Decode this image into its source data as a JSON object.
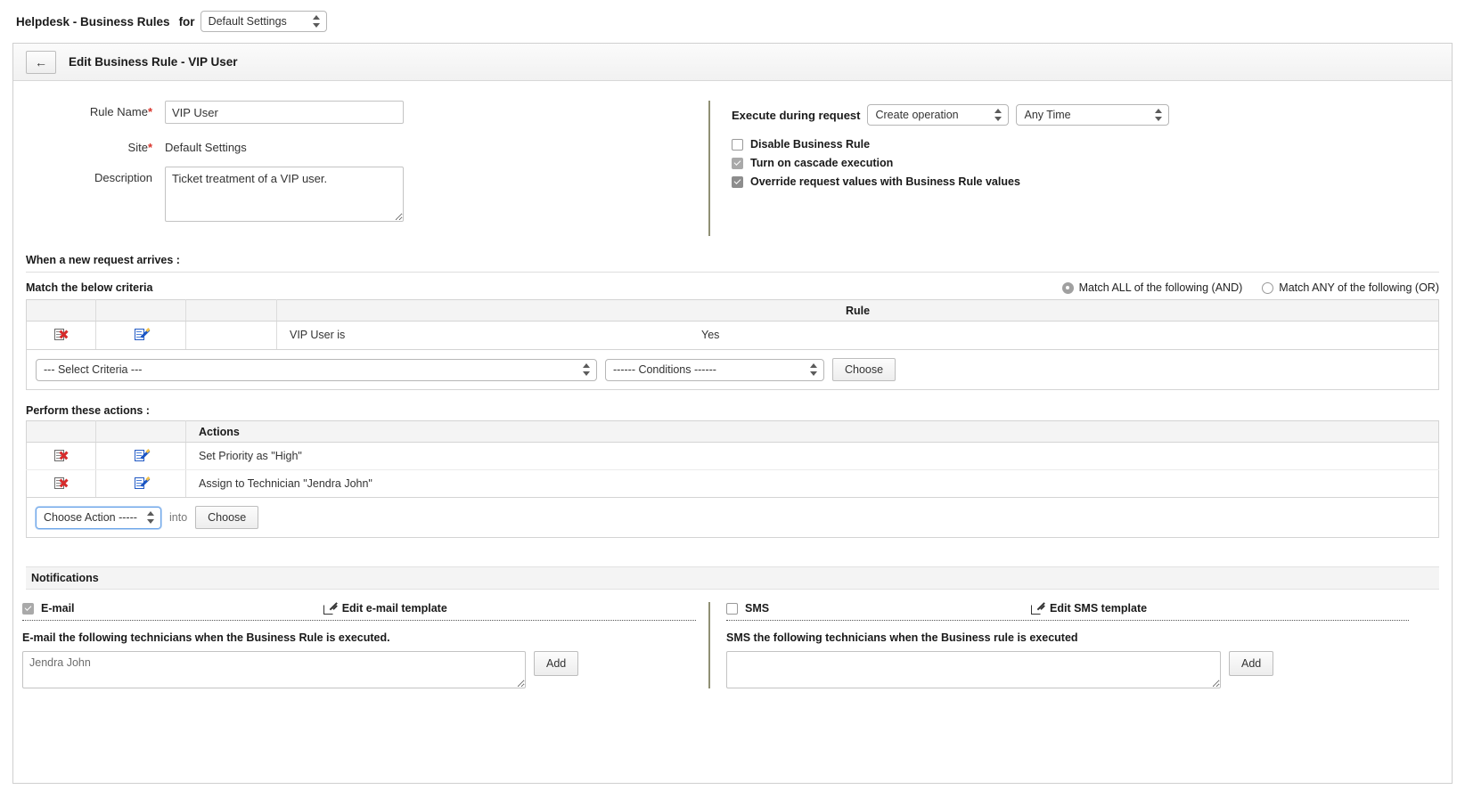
{
  "topbar": {
    "title_strong": "Helpdesk - Business Rules",
    "for_label": "for",
    "site_select_value": "Default Settings",
    "site_select_name": "site-scope-select"
  },
  "panel": {
    "back_icon": "arrow-left-icon",
    "heading": "Edit Business Rule - VIP User"
  },
  "form": {
    "rule_name_label": "Rule Name",
    "rule_name_value": "VIP User",
    "site_label": "Site",
    "site_value": "Default Settings",
    "description_label": "Description",
    "description_value": "Ticket treatment of a VIP user.",
    "required_marker": "*"
  },
  "execute": {
    "label": "Execute during request",
    "operation_value": "Create operation",
    "time_value": "Any Time",
    "options": [
      {
        "label": "Disable Business Rule",
        "checked": false
      },
      {
        "label": "Turn on cascade execution",
        "checked": true
      },
      {
        "label": "Override request values with Business Rule values",
        "checked": true
      }
    ]
  },
  "criteria": {
    "section_title": "When a new request arrives :",
    "sub_title": "Match the below criteria",
    "match_all_label": "Match ALL of the following (AND)",
    "match_any_label": "Match ANY of the following (OR)",
    "match_selected": "all",
    "columns": [
      "",
      "",
      "",
      "Rule"
    ],
    "rows": [
      {
        "delete_icon": "delete-row-icon",
        "edit_icon": "edit-row-icon",
        "name": "VIP User is",
        "value": "Yes"
      }
    ],
    "builder": {
      "criteria_select_value": "--- Select Criteria ---",
      "condition_select_value": "------ Conditions ------",
      "choose_button": "Choose"
    }
  },
  "actions": {
    "section_title": "Perform these actions :",
    "columns": [
      "",
      "",
      "Actions"
    ],
    "rows": [
      {
        "delete_icon": "delete-row-icon",
        "edit_icon": "edit-row-icon",
        "text": "Set Priority as \"High\""
      },
      {
        "delete_icon": "delete-row-icon",
        "edit_icon": "edit-row-icon",
        "text": "Assign to Technician \"Jendra John\""
      }
    ],
    "builder": {
      "action_select_value": "Choose Action -------",
      "into_label": "into",
      "choose_button": "Choose"
    }
  },
  "notifications": {
    "bar_title": "Notifications",
    "email": {
      "checkbox_label": "E-mail",
      "checked": true,
      "template_link": "Edit e-mail template",
      "template_icon": "edit-template-icon",
      "description": "E-mail the following technicians when the Business Rule is executed.",
      "recipients_value": "Jendra John",
      "add_button": "Add"
    },
    "sms": {
      "checkbox_label": "SMS",
      "checked": false,
      "template_link": "Edit SMS template",
      "template_icon": "edit-template-icon",
      "description": "SMS the following technicians when the Business rule is executed",
      "recipients_value": "",
      "add_button": "Add"
    }
  },
  "colors": {
    "required": "#d9342b",
    "delete_icon": "#d62b2b",
    "edit_icon": "#1b56c4",
    "divider": "#6b6b47",
    "focus": "#6ba4e8"
  }
}
